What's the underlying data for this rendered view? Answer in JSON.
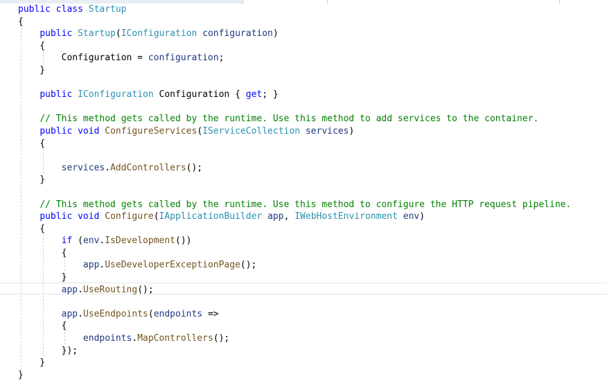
{
  "editor": {
    "lines": [
      [
        {
          "t": "public",
          "c": "kw"
        },
        {
          "t": " "
        },
        {
          "t": "class",
          "c": "kw"
        },
        {
          "t": " "
        },
        {
          "t": "Startup",
          "c": "ty"
        }
      ],
      [
        {
          "t": "{"
        }
      ],
      [
        {
          "t": "    "
        },
        {
          "t": "public",
          "c": "kw"
        },
        {
          "t": " "
        },
        {
          "t": "Startup",
          "c": "ty"
        },
        {
          "t": "("
        },
        {
          "t": "IConfiguration",
          "c": "ty"
        },
        {
          "t": " "
        },
        {
          "t": "configuration",
          "c": "pa"
        },
        {
          "t": ")"
        }
      ],
      [
        {
          "t": "    {"
        }
      ],
      [
        {
          "t": "        Configuration = "
        },
        {
          "t": "configuration",
          "c": "pa"
        },
        {
          "t": ";"
        }
      ],
      [
        {
          "t": "    }"
        }
      ],
      [],
      [
        {
          "t": "    "
        },
        {
          "t": "public",
          "c": "kw"
        },
        {
          "t": " "
        },
        {
          "t": "IConfiguration",
          "c": "ty"
        },
        {
          "t": " Configuration { "
        },
        {
          "t": "get",
          "c": "kw"
        },
        {
          "t": "; }"
        }
      ],
      [],
      [
        {
          "t": "    "
        },
        {
          "t": "// This method gets called by the runtime. Use this method to add services to the container.",
          "c": "cm"
        }
      ],
      [
        {
          "t": "    "
        },
        {
          "t": "public",
          "c": "kw"
        },
        {
          "t": " "
        },
        {
          "t": "void",
          "c": "kw"
        },
        {
          "t": " "
        },
        {
          "t": "ConfigureServices",
          "c": "me"
        },
        {
          "t": "("
        },
        {
          "t": "IServiceCollection",
          "c": "ty"
        },
        {
          "t": " "
        },
        {
          "t": "services",
          "c": "pa"
        },
        {
          "t": ")"
        }
      ],
      [
        {
          "t": "    {"
        }
      ],
      [],
      [
        {
          "t": "        "
        },
        {
          "t": "services",
          "c": "pa"
        },
        {
          "t": "."
        },
        {
          "t": "AddControllers",
          "c": "me"
        },
        {
          "t": "();"
        }
      ],
      [
        {
          "t": "    }"
        }
      ],
      [],
      [
        {
          "t": "    "
        },
        {
          "t": "// This method gets called by the runtime. Use this method to configure the HTTP request pipeline.",
          "c": "cm"
        }
      ],
      [
        {
          "t": "    "
        },
        {
          "t": "public",
          "c": "kw"
        },
        {
          "t": " "
        },
        {
          "t": "void",
          "c": "kw"
        },
        {
          "t": " "
        },
        {
          "t": "Configure",
          "c": "me"
        },
        {
          "t": "("
        },
        {
          "t": "IApplicationBuilder",
          "c": "ty"
        },
        {
          "t": " "
        },
        {
          "t": "app",
          "c": "pa"
        },
        {
          "t": ", "
        },
        {
          "t": "IWebHostEnvironment",
          "c": "ty"
        },
        {
          "t": " "
        },
        {
          "t": "env",
          "c": "pa"
        },
        {
          "t": ")"
        }
      ],
      [
        {
          "t": "    {"
        }
      ],
      [
        {
          "t": "        "
        },
        {
          "t": "if",
          "c": "kw"
        },
        {
          "t": " ("
        },
        {
          "t": "env",
          "c": "pa"
        },
        {
          "t": "."
        },
        {
          "t": "IsDevelopment",
          "c": "me"
        },
        {
          "t": "())"
        }
      ],
      [
        {
          "t": "        {"
        }
      ],
      [
        {
          "t": "            "
        },
        {
          "t": "app",
          "c": "pa"
        },
        {
          "t": "."
        },
        {
          "t": "UseDeveloperExceptionPage",
          "c": "me"
        },
        {
          "t": "();"
        }
      ],
      [
        {
          "t": "        }"
        }
      ],
      [
        {
          "t": "        "
        },
        {
          "t": "app",
          "c": "pa"
        },
        {
          "t": "."
        },
        {
          "t": "UseRouting",
          "c": "me"
        },
        {
          "t": "();"
        }
      ],
      [],
      [
        {
          "t": "        "
        },
        {
          "t": "app",
          "c": "pa"
        },
        {
          "t": "."
        },
        {
          "t": "UseEndpoints",
          "c": "me"
        },
        {
          "t": "("
        },
        {
          "t": "endpoints",
          "c": "pa"
        },
        {
          "t": " =>"
        }
      ],
      [
        {
          "t": "        {"
        }
      ],
      [
        {
          "t": "            "
        },
        {
          "t": "endpoints",
          "c": "pa"
        },
        {
          "t": "."
        },
        {
          "t": "MapControllers",
          "c": "me"
        },
        {
          "t": "();"
        }
      ],
      [
        {
          "t": "        });"
        }
      ],
      [
        {
          "t": "    }"
        }
      ],
      [
        {
          "t": "}"
        }
      ]
    ]
  },
  "colors": {
    "keyword": "#0000ff",
    "type": "#2b91af",
    "method": "#74531f",
    "parameter": "#1f377f",
    "comment": "#008000",
    "text": "#000000",
    "background": "#ffffff"
  }
}
